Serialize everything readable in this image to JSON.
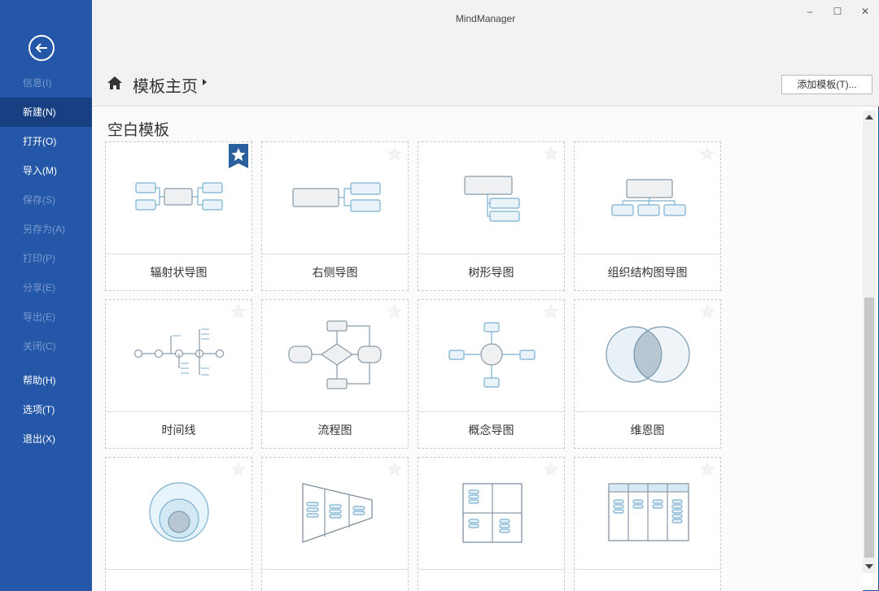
{
  "window": {
    "title": "MindManager",
    "controls": {
      "minimize": "–",
      "maximize": "☐",
      "close": "✕"
    }
  },
  "sidebar": {
    "back_icon": "arrow-left-circle-icon",
    "items": [
      {
        "label": "信息(I)",
        "state": "dim"
      },
      {
        "label": "新建(N)",
        "state": "active"
      },
      {
        "label": "打开(O)",
        "state": "normal"
      },
      {
        "label": "导入(M)",
        "state": "normal"
      },
      {
        "label": "保存(S)",
        "state": "dim"
      },
      {
        "label": "另存为(A)",
        "state": "dim"
      },
      {
        "label": "打印(P)",
        "state": "dim"
      },
      {
        "label": "分享(E)",
        "state": "dim"
      },
      {
        "label": "导出(E)",
        "state": "dim"
      },
      {
        "label": "关闭(C)",
        "state": "dim"
      },
      {
        "label": "帮助(H)",
        "state": "normal"
      },
      {
        "label": "选项(T)",
        "state": "normal"
      },
      {
        "label": "退出(X)",
        "state": "normal"
      }
    ]
  },
  "header": {
    "home_icon": "home-icon",
    "breadcrumb": "模板主页",
    "add_template_button": "添加模板(T)..."
  },
  "main": {
    "section_title": "空白模板",
    "templates": [
      {
        "label": "辐射状导图",
        "diagram": "radial",
        "favorite": true
      },
      {
        "label": "右侧导图",
        "diagram": "right",
        "favorite": false
      },
      {
        "label": "树形导图",
        "diagram": "tree",
        "favorite": false
      },
      {
        "label": "组织结构图导图",
        "diagram": "org",
        "favorite": false
      },
      {
        "label": "时间线",
        "diagram": "timeline",
        "favorite": false
      },
      {
        "label": "流程图",
        "diagram": "flow",
        "favorite": false
      },
      {
        "label": "概念导图",
        "diagram": "concept",
        "favorite": false
      },
      {
        "label": "维恩图",
        "diagram": "venn",
        "favorite": false
      },
      {
        "label": "",
        "diagram": "onion",
        "favorite": false
      },
      {
        "label": "",
        "diagram": "funnel",
        "favorite": false
      },
      {
        "label": "",
        "diagram": "matrix",
        "favorite": false
      },
      {
        "label": "",
        "diagram": "swimlane",
        "favorite": false
      }
    ]
  },
  "colors": {
    "sidebar_bg": "#2457a7",
    "sidebar_active": "#173f82",
    "node_stroke": "#7ab0d0",
    "node_fill": "#eaf3f9",
    "star_badge": "#2a5f9e"
  }
}
